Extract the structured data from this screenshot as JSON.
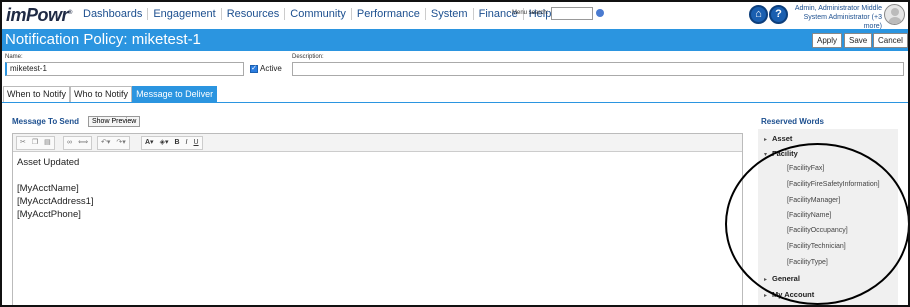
{
  "brand": {
    "name": "imPowr",
    "mark": "®"
  },
  "nav": {
    "items": [
      "Dashboards",
      "Engagement",
      "Resources",
      "Community",
      "Performance",
      "System",
      "Finance",
      "Help"
    ],
    "menu_search_label": "Menu search:"
  },
  "user": {
    "name": "Admin, Administrator Middle",
    "role": "System Administrator (+3 more)"
  },
  "page": {
    "title": "Notification Policy: miketest-1",
    "actions": {
      "apply": "Apply",
      "save": "Save",
      "cancel": "Cancel"
    }
  },
  "form": {
    "name_label": "Name:",
    "name_value": "miketest-1",
    "active_label": "Active",
    "active_checked": true,
    "description_label": "Description:",
    "description_value": ""
  },
  "tabs": [
    {
      "label": "When to Notify",
      "active": false
    },
    {
      "label": "Who to Notify",
      "active": false
    },
    {
      "label": "Message to Deliver",
      "active": true
    }
  ],
  "message": {
    "heading": "Message To Send",
    "preview_button": "Show Preview",
    "lines": [
      "Asset Updated",
      "",
      "[MyAcctName]",
      "[MyAcctAddress1]",
      "[MyAcctPhone]"
    ]
  },
  "reserved_words": {
    "heading": "Reserved Words",
    "groups": [
      {
        "label": "Asset",
        "expanded": false
      },
      {
        "label": "Facility",
        "expanded": true,
        "children": [
          "[FacilityFax]",
          "[FacilityFireSafetyInformation]",
          "[FacilityManager]",
          "[FacilityName]",
          "[FacilityOccupancy]",
          "[FacilityTechnician]",
          "[FacilityType]"
        ]
      },
      {
        "label": "General",
        "expanded": false
      },
      {
        "label": "My Account",
        "expanded": false
      }
    ]
  },
  "colors": {
    "accent": "#2b95e0",
    "link": "#1c4f8f"
  }
}
